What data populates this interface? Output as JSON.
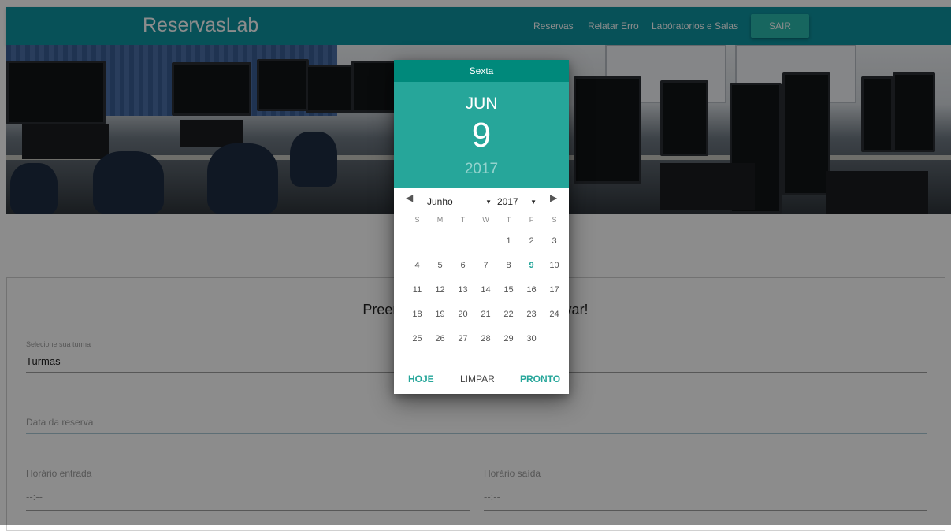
{
  "app": {
    "brand": "ReservasLab",
    "nav": {
      "reservas": "Reservas",
      "relatar_erro": "Relatar Erro",
      "laboratorios": "Labóratorios e Salas",
      "sair": "SAIR"
    }
  },
  "form": {
    "title": "Preencha os campos para reservar!",
    "turma_label": "Selecione sua turma",
    "turma_value": "Turmas",
    "data_label": "Data da reserva",
    "horario_entrada_label": "Horário entrada",
    "horario_entrada_value": "--:--",
    "horario_saida_label": "Horário saída",
    "horario_saida_value": "--:--"
  },
  "datepicker": {
    "weekday": "Sexta",
    "month_short": "JUN",
    "day": "9",
    "year": "2017",
    "month_select": "Junho",
    "year_select": "2017",
    "prev_arrow": "◀",
    "next_arrow": "▶",
    "caret": "▼",
    "dow": [
      "S",
      "M",
      "T",
      "W",
      "T",
      "F",
      "S"
    ],
    "weeks": [
      [
        "",
        "",
        "",
        "",
        "1",
        "2",
        "3"
      ],
      [
        "4",
        "5",
        "6",
        "7",
        "8",
        "9",
        "10"
      ],
      [
        "11",
        "12",
        "13",
        "14",
        "15",
        "16",
        "17"
      ],
      [
        "18",
        "19",
        "20",
        "21",
        "22",
        "23",
        "24"
      ],
      [
        "25",
        "26",
        "27",
        "28",
        "29",
        "30",
        ""
      ]
    ],
    "selected_day": "9",
    "buttons": {
      "today": "HOJE",
      "clear": "LIMPAR",
      "done": "PRONTO"
    }
  },
  "colors": {
    "navbar": "#0e94a0",
    "accent": "#26a69a",
    "accent_dark": "#00897b"
  }
}
